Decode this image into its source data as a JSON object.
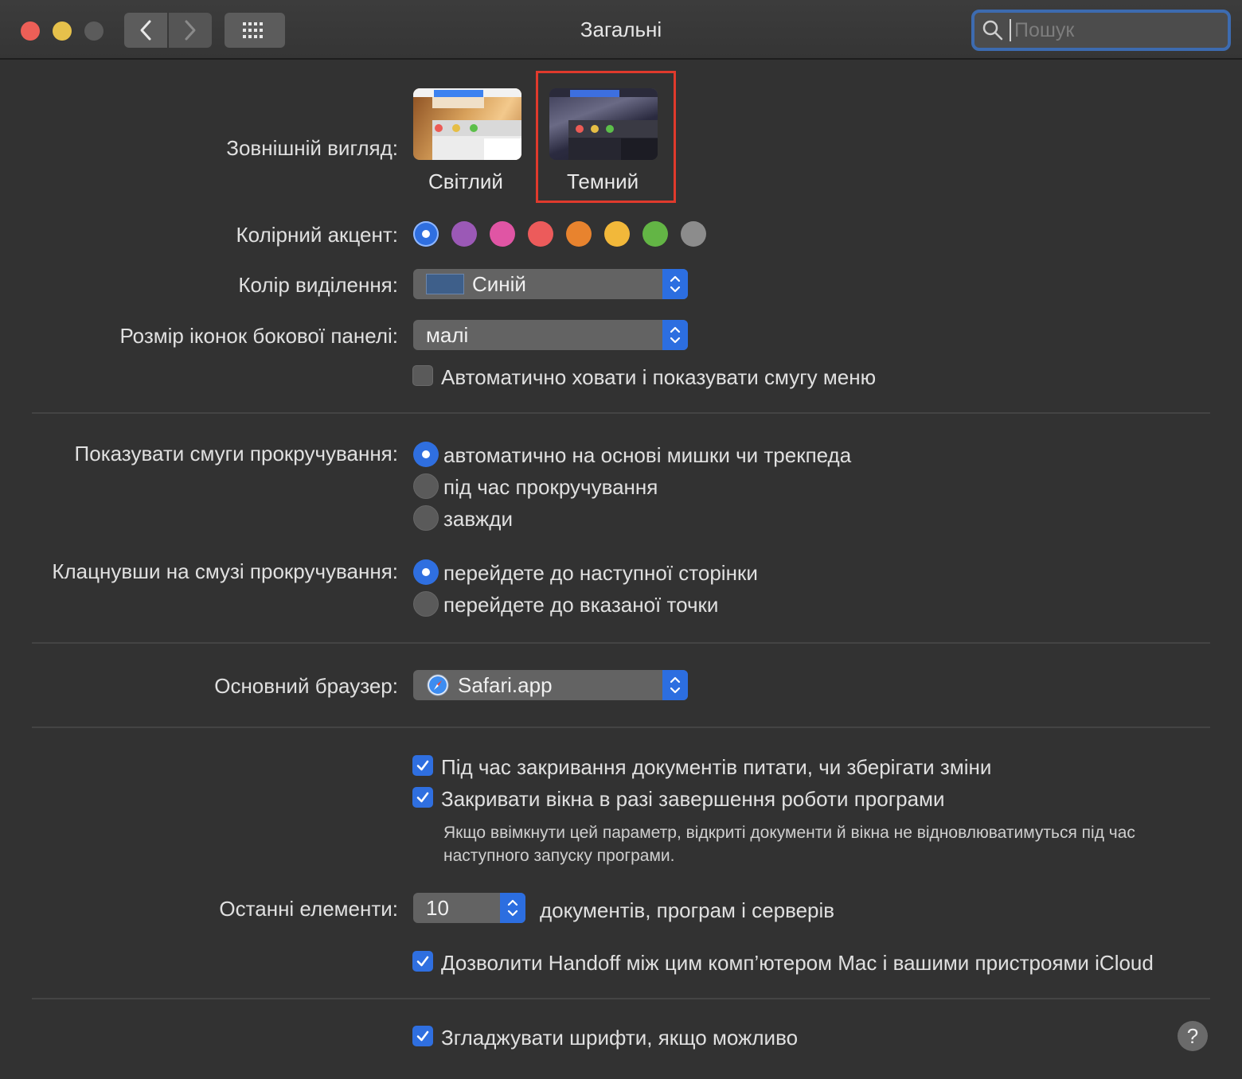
{
  "window": {
    "title": "Загальні"
  },
  "search": {
    "placeholder": "Пошук"
  },
  "appearance": {
    "label": "Зовнішній вигляд:",
    "options": [
      {
        "label": "Світлий",
        "selected": false
      },
      {
        "label": "Темний",
        "selected": true
      }
    ]
  },
  "accent": {
    "label": "Колірний акцент:",
    "colors": [
      "#2f6fe0",
      "#9b59b6",
      "#e055a4",
      "#ec5b5b",
      "#e8832e",
      "#f2b83a",
      "#63b545",
      "#8c8c8c"
    ],
    "selected_index": 0
  },
  "highlight": {
    "label": "Колір виділення:",
    "value": "Синій",
    "swatch_color": "#3e5f8a"
  },
  "sidebar_icons": {
    "label": "Розмір іконок бокової панелі:",
    "value": "малі"
  },
  "menubar": {
    "label": "Автоматично ховати і показувати смугу меню",
    "checked": false
  },
  "scrollbars": {
    "label": "Показувати смуги прокручування:",
    "options": [
      {
        "label": "автоматично на основі мишки чи трекпеда",
        "selected": true
      },
      {
        "label": "під час прокручування",
        "selected": false
      },
      {
        "label": "завжди",
        "selected": false
      }
    ]
  },
  "scroll_click": {
    "label": "Клацнувши на смузі прокручування:",
    "options": [
      {
        "label": "перейдете до наступної сторінки",
        "selected": true
      },
      {
        "label": "перейдете до вказаної точки",
        "selected": false
      }
    ]
  },
  "browser": {
    "label": "Основний браузер:",
    "value": "Safari.app"
  },
  "ask_save": {
    "label": "Під час закривання документів питати, чи зберігати зміни",
    "checked": true
  },
  "close_windows": {
    "label": "Закривати вікна в разі завершення роботи програми",
    "checked": true,
    "note": "Якщо ввімкнути цей параметр, відкриті документи й вікна не відновлюватимуться під час наступного запуску програми."
  },
  "recent": {
    "label": "Останні елементи:",
    "value": "10",
    "suffix": "документів, програм і серверів"
  },
  "handoff": {
    "label": "Дозволити Handoff між цим комп’ютером Mac і вашими пристроями iCloud",
    "checked": true
  },
  "smoothing": {
    "label": "Згладжувати шрифти, якщо можливо",
    "checked": true
  },
  "help": {
    "label": "?"
  }
}
